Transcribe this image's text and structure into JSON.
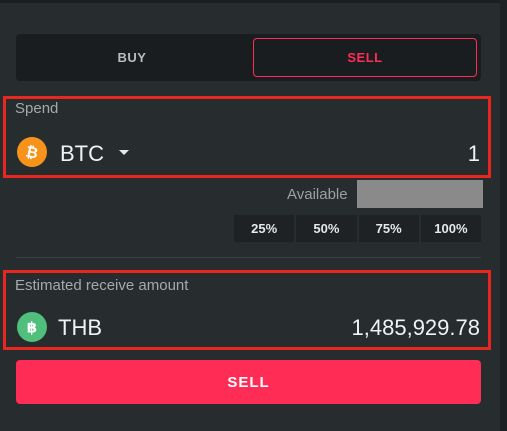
{
  "toggle": {
    "buy_label": "BUY",
    "sell_label": "SELL",
    "selected": "SELL"
  },
  "spend": {
    "label": "Spend",
    "currency": "BTC",
    "currency_icon": "bitcoin-icon",
    "amount": "1"
  },
  "available": {
    "label": "Available"
  },
  "percent_options": [
    "25%",
    "50%",
    "75%",
    "100%"
  ],
  "receive": {
    "label": "Estimated receive amount",
    "currency": "THB",
    "currency_icon": "thb-coin-icon",
    "amount": "1,485,929.78"
  },
  "submit": {
    "label": "SELL"
  },
  "colors": {
    "accent": "#ff2d55",
    "highlight": "#e8271f",
    "btc": "#f7931a",
    "thb": "#4fbf7b",
    "background": "#272c2e"
  }
}
